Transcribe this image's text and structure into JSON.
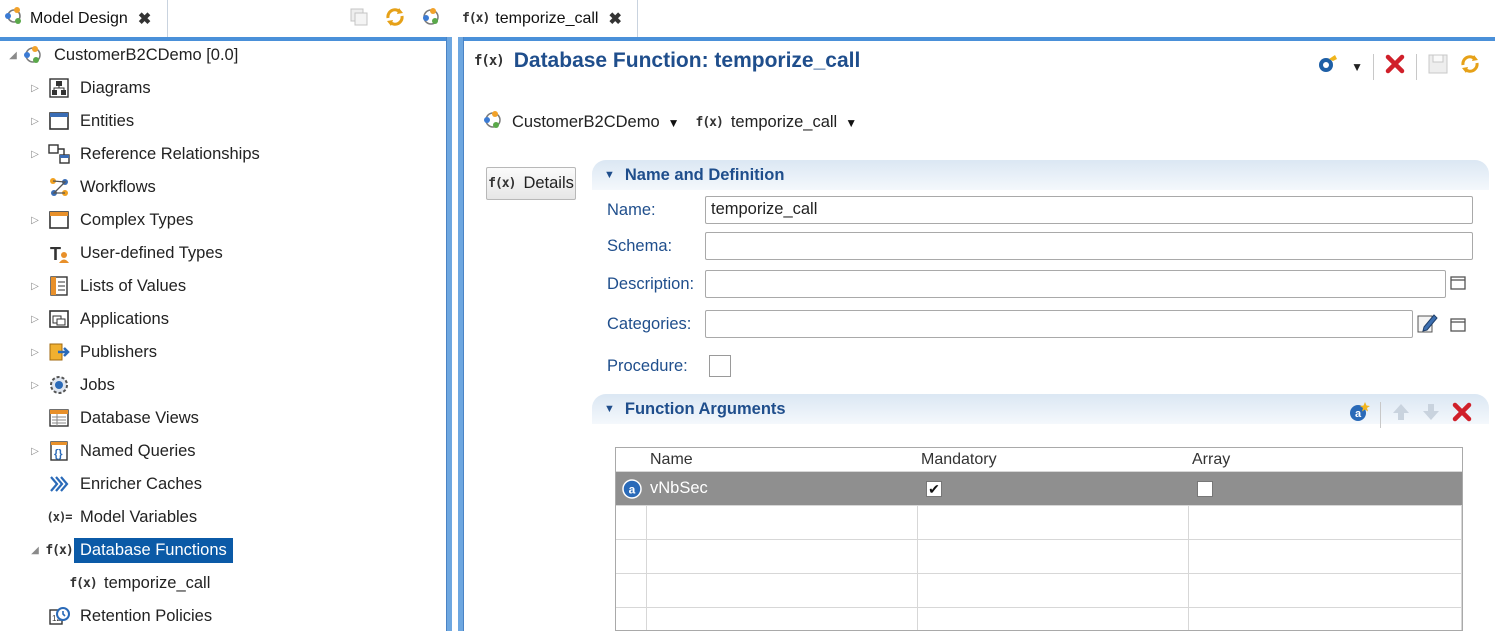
{
  "left_panel": {
    "tab_label": "Model Design",
    "tree": {
      "root": "CustomerB2CDemo [0.0]",
      "items": [
        {
          "label": "Diagrams",
          "icon": "diagram-icon",
          "expandable": true
        },
        {
          "label": "Entities",
          "icon": "entity-icon",
          "expandable": true
        },
        {
          "label": "Reference Relationships",
          "icon": "relationship-icon",
          "expandable": true
        },
        {
          "label": "Workflows",
          "icon": "workflow-icon",
          "expandable": false
        },
        {
          "label": "Complex Types",
          "icon": "complex-type-icon",
          "expandable": true
        },
        {
          "label": "User-defined Types",
          "icon": "user-type-icon",
          "expandable": false
        },
        {
          "label": "Lists of Values",
          "icon": "list-icon",
          "expandable": true
        },
        {
          "label": "Applications",
          "icon": "application-icon",
          "expandable": true
        },
        {
          "label": "Publishers",
          "icon": "publisher-icon",
          "expandable": true
        },
        {
          "label": "Jobs",
          "icon": "gear-icon",
          "expandable": true
        },
        {
          "label": "Database Views",
          "icon": "view-icon",
          "expandable": false
        },
        {
          "label": "Named Queries",
          "icon": "query-icon",
          "expandable": true
        },
        {
          "label": "Enricher Caches",
          "icon": "enricher-icon",
          "expandable": false
        },
        {
          "label": "Model Variables",
          "icon": "variable-icon",
          "expandable": false
        },
        {
          "label": "Database Functions",
          "icon": "function-icon",
          "expandable": true,
          "expanded": true,
          "selected": true
        },
        {
          "label": "temporize_call",
          "icon": "function-icon",
          "child": true
        },
        {
          "label": "Retention Policies",
          "icon": "retention-icon",
          "expandable": false
        }
      ]
    }
  },
  "editor": {
    "tab_label": "temporize_call",
    "fx_glyph": "f(x)",
    "variable_glyph": "(x)=",
    "title": "Database Function: temporize_call",
    "breadcrumb": {
      "model": "CustomerB2CDemo",
      "function": "temporize_call"
    },
    "details_button": "Details",
    "section_definition": "Name and Definition",
    "fields": {
      "name_label": "Name:",
      "name_value": "temporize_call",
      "schema_label": "Schema:",
      "schema_value": "",
      "description_label": "Description:",
      "description_value": "",
      "categories_label": "Categories:",
      "categories_value": "",
      "procedure_label": "Procedure:",
      "procedure_checked": false
    },
    "section_arguments": "Function Arguments",
    "arguments_table": {
      "columns": [
        "Name",
        "Mandatory",
        "Array"
      ],
      "rows": [
        {
          "name": "vNbSec",
          "mandatory": true,
          "array": false
        }
      ]
    },
    "colors": {
      "accent": "#1f4e8c",
      "tab_highlight": "#4a90d9",
      "selection": "#0b5aa7",
      "delete": "#d0202a"
    }
  }
}
